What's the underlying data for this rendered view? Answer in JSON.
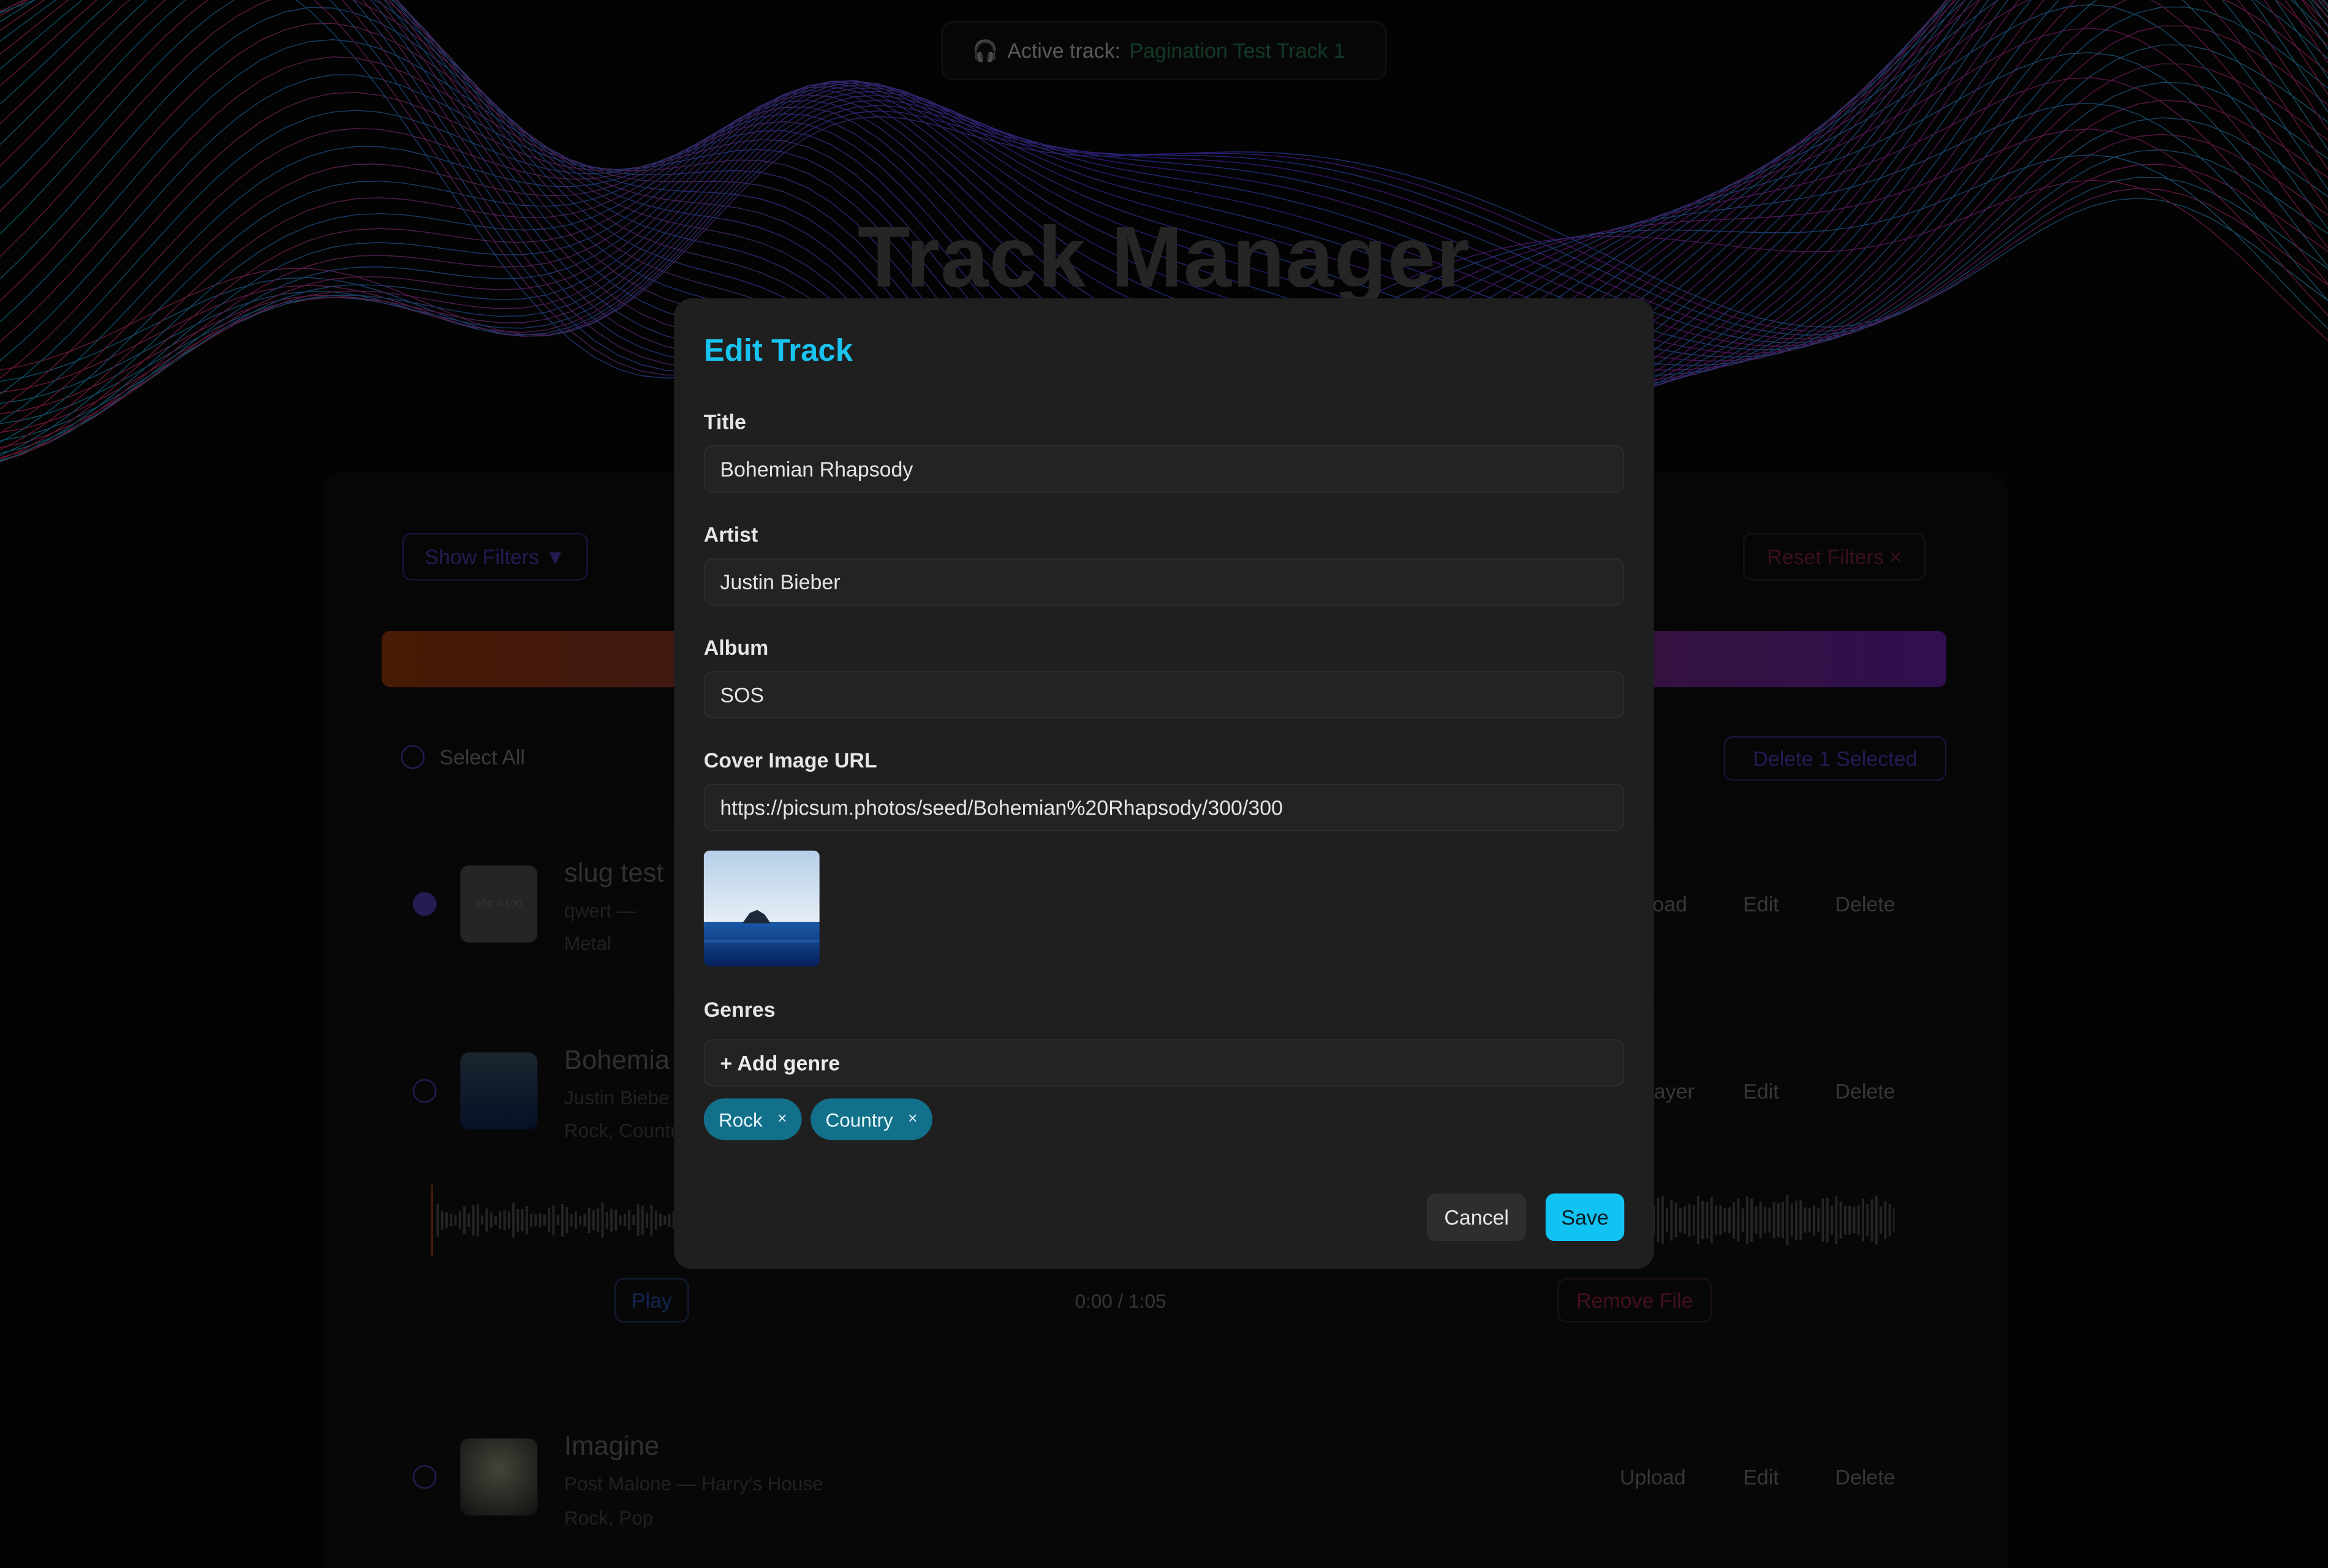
{
  "header": {
    "active_label": "Active track:",
    "active_track": "Pagination Test Track 1",
    "page_title": "Track Manager"
  },
  "toolbar": {
    "show_filters": "Show Filters ▼",
    "reset_filters": "Reset Filters ×",
    "select_all": "Select All",
    "delete_selected": "Delete 1 Selected"
  },
  "tracks": [
    {
      "title": "slug test",
      "subtitle": "qwert —",
      "genres": "Metal",
      "thumb_text": "100 × 100",
      "actions": [
        "oad",
        "Edit",
        "Delete"
      ],
      "selected": true
    },
    {
      "title": "Bohemia",
      "subtitle": "Justin Biebe",
      "genres": "Rock, Countr",
      "actions": [
        "ayer",
        "Edit",
        "Delete"
      ],
      "selected": false,
      "player": {
        "play": "Play",
        "time": "0:00 / 1:05",
        "remove": "Remove File"
      }
    },
    {
      "title": "Imagine",
      "subtitle": "Post Malone — Harry's House",
      "genres": "Rock, Pop",
      "actions": [
        "Upload",
        "Edit",
        "Delete"
      ],
      "selected": false
    }
  ],
  "modal": {
    "heading": "Edit Track",
    "title_label": "Title",
    "title_value": "Bohemian Rhapsody",
    "artist_label": "Artist",
    "artist_value": "Justin Bieber",
    "album_label": "Album",
    "album_value": "SOS",
    "cover_label": "Cover Image URL",
    "cover_value": "https://picsum.photos/seed/Bohemian%20Rhapsody/300/300",
    "genres_label": "Genres",
    "add_genre": "+ Add genre",
    "genres": [
      "Rock",
      "Country"
    ],
    "chip_remove": "×",
    "cancel": "Cancel",
    "save": "Save"
  },
  "colors": {
    "accent": "#19c3ef",
    "save_bg": "#10c3f2",
    "chip_bg": "#12708a",
    "modal_bg": "#1f1f20"
  }
}
